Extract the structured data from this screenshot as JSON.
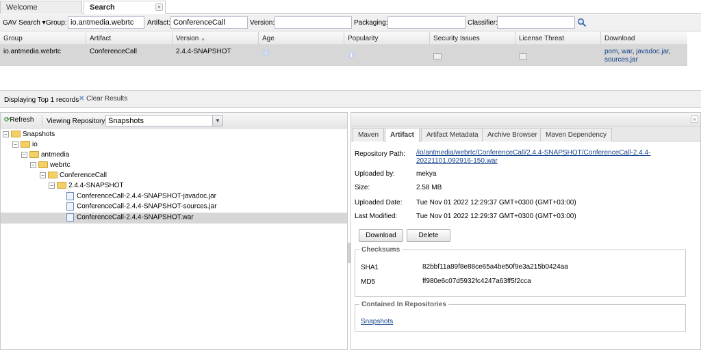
{
  "top_tabs": [
    {
      "label": "Welcome"
    },
    {
      "label": "Search",
      "close": "×"
    }
  ],
  "search": {
    "mode_label": "GAV Search",
    "group_label": "Group:",
    "group_value": "io.antmedia.webrtc",
    "artifact_label": "Artifact:",
    "artifact_value": "ConferenceCall",
    "version_label": "Version:",
    "version_value": "",
    "packaging_label": "Packaging:",
    "packaging_value": "",
    "classifier_label": "Classifier:",
    "classifier_value": ""
  },
  "grid": {
    "columns": [
      "Group",
      "Artifact",
      "Version",
      "Age",
      "Popularity",
      "Security Issues",
      "License Threat",
      "Download"
    ],
    "rows": [
      {
        "group": "io.antmedia.webrtc",
        "artifact": "ConferenceCall",
        "version": "2.4.4-SNAPSHOT",
        "download_links": [
          "pom",
          "war",
          "javadoc.jar",
          "sources.jar"
        ]
      }
    ]
  },
  "results_bar": {
    "displaying": "Displaying Top 1 records",
    "clear": "Clear Results"
  },
  "repo_browser": {
    "refresh": "Refresh",
    "viewing_label": "Viewing Repository:",
    "repository": "Snapshots",
    "tree": [
      {
        "label": "Snapshots",
        "type": "folder",
        "depth": 0
      },
      {
        "label": "io",
        "type": "folder",
        "depth": 1
      },
      {
        "label": "antmedia",
        "type": "folder",
        "depth": 2
      },
      {
        "label": "webrtc",
        "type": "folder",
        "depth": 3
      },
      {
        "label": "ConferenceCall",
        "type": "folder",
        "depth": 4
      },
      {
        "label": "2.4.4-SNAPSHOT",
        "type": "folder",
        "depth": 5
      },
      {
        "label": "ConferenceCall-2.4.4-SNAPSHOT-javadoc.jar",
        "type": "file",
        "depth": 6
      },
      {
        "label": "ConferenceCall-2.4.4-SNAPSHOT-sources.jar",
        "type": "file",
        "depth": 6
      },
      {
        "label": "ConferenceCall-2.4.4-SNAPSHOT.war",
        "type": "file",
        "depth": 6,
        "selected": true
      }
    ]
  },
  "detail": {
    "collapse": "»",
    "tabs": [
      "Maven",
      "Artifact",
      "Artifact Metadata",
      "Archive Browser",
      "Maven Dependency"
    ],
    "active_tab": "Artifact",
    "repository_path_label": "Repository Path:",
    "repository_path_line1": "/io/antmedia/webrtc/ConferenceCall/2.4.4-SNAPSHOT/ConferenceCall-2.4.4-",
    "repository_path_line2": "20221101.092916-150.war",
    "uploaded_by_label": "Uploaded by:",
    "uploaded_by": "mekya",
    "size_label": "Size:",
    "size": "2.58 MB",
    "uploaded_date_label": "Uploaded Date:",
    "uploaded_date": "Tue Nov 01 2022 12:29:37 GMT+0300 (GMT+03:00)",
    "last_modified_label": "Last Modified:",
    "last_modified": "Tue Nov 01 2022 12:29:37 GMT+0300 (GMT+03:00)",
    "download_button": "Download",
    "delete_button": "Delete",
    "checksums_title": "Checksums",
    "sha1_label": "SHA1",
    "sha1": "82bbf11a89f8e88ce65a4be50f9e3a215b0424aa",
    "md5_label": "MD5",
    "md5": "ff980e6c07d5932fc4247a63ff5f2cca",
    "contained_title": "Contained In Repositories",
    "contained_repo": "Snapshots"
  }
}
